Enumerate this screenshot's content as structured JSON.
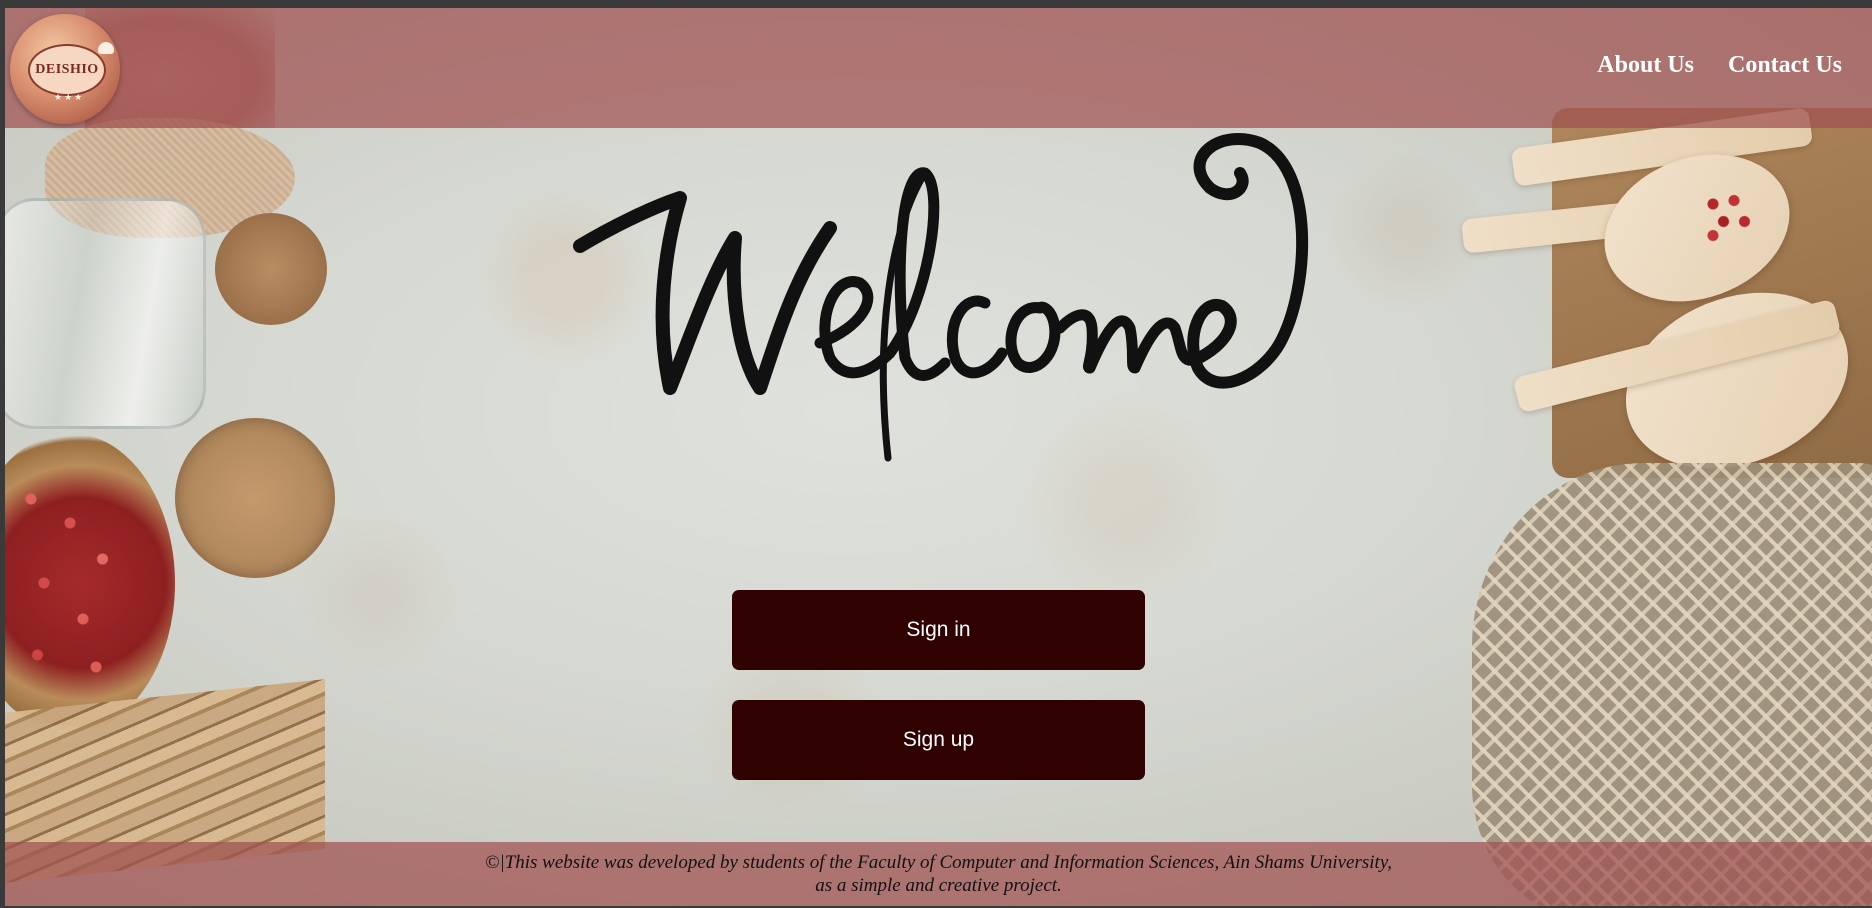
{
  "header": {
    "logo_text": "DEISHIO",
    "logo_stars": "★★★",
    "nav": {
      "about": "About Us",
      "contact": "Contact Us"
    }
  },
  "hero": {
    "welcome_text": "Welcome"
  },
  "actions": {
    "sign_in": "Sign in",
    "sign_up": "Sign up"
  },
  "footer": {
    "line1": "©|This website was developed by students of the Faculty of Computer and Information Sciences, Ain Shams University,",
    "line2": "as a simple and creative project."
  },
  "colors": {
    "header_footer_overlay": "#a05050",
    "button_bg": "#2f0101",
    "button_text": "#ffffff",
    "nav_text": "#ffffff"
  }
}
